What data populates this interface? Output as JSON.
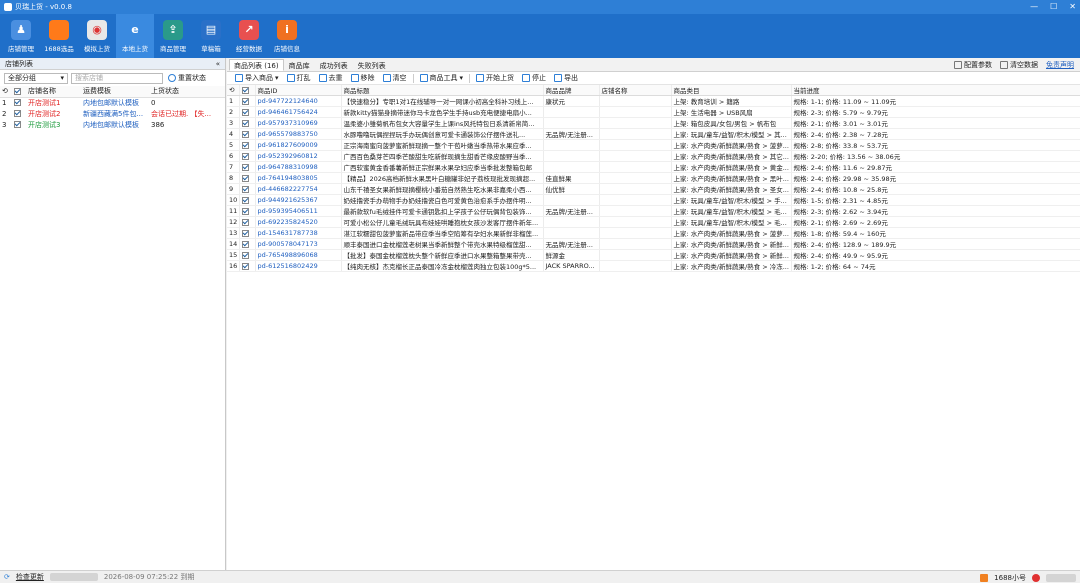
{
  "window": {
    "title": "贝瑞上货 - v0.0.8",
    "minimize": "—",
    "maximize": "☐",
    "close": "✕"
  },
  "toolbar": [
    {
      "label": "店铺管理",
      "icon": "user-icon",
      "color": "#4a8fe0",
      "glyph": "♟"
    },
    {
      "label": "1688选品",
      "icon": "1688-icon",
      "color": "#ff7a1a",
      "glyph": ""
    },
    {
      "label": "模拟上货",
      "icon": "chrome-icon",
      "color": "#e8e8e8",
      "glyph": "◉"
    },
    {
      "label": "本地上货",
      "icon": "ie-icon",
      "color": "#3a8ae0",
      "glyph": "e"
    },
    {
      "label": "商品管理",
      "icon": "upload-box-icon",
      "color": "#2a9a8a",
      "glyph": "⇪"
    },
    {
      "label": "草稿箱",
      "icon": "draft-icon",
      "color": "#2a70c8",
      "glyph": "▤"
    },
    {
      "label": "经营数据",
      "icon": "chart-icon",
      "color": "#e85050",
      "glyph": "↗"
    },
    {
      "label": "店铺信息",
      "icon": "info-icon",
      "color": "#f07020",
      "glyph": "i"
    }
  ],
  "left": {
    "title": "店铺列表",
    "collapse": "«",
    "group_select": "全部分组",
    "search_placeholder": "搜索店铺",
    "reset_label": "重置状态",
    "columns": [
      "",
      "",
      "店铺名称",
      "运费模板",
      "上货状态"
    ],
    "shops": [
      {
        "n": "1",
        "name": "开店测试1",
        "tpl": "内地包邮默认模板",
        "status": "0",
        "name_color": "red",
        "status_color": ""
      },
      {
        "n": "2",
        "name": "开店测试2",
        "tpl": "新疆西藏满5件包...",
        "status": "会话已过期. 【失...",
        "name_color": "red",
        "status_color": "red"
      },
      {
        "n": "3",
        "name": "开店测试3",
        "tpl": "内地包邮默认模板",
        "status": "386",
        "name_color": "green",
        "status_color": ""
      }
    ]
  },
  "tabs": [
    "商品列表 (16)",
    "商品库",
    "成功列表",
    "失败列表"
  ],
  "right_links": {
    "config": "配置参数",
    "clear": "清空数据",
    "disclaimer": "免责声明"
  },
  "actions": [
    "导入商品",
    "打乱",
    "去重",
    "移除",
    "清空",
    "商品工具",
    "开始上货",
    "停止",
    "导出"
  ],
  "goods_columns": [
    "",
    "",
    "商品ID",
    "商品标题",
    "商品品牌",
    "店铺名称",
    "商品类目",
    "当前进度"
  ],
  "goods": [
    [
      "1",
      "pd-947722124640",
      "【快速稳分】专职1对1在线辅导一对一网课小初高全科补习线上...",
      "康状元",
      "",
      "上架: 教育培训 > 籍路",
      "规格: 1-1; 价格: 11.09 ~ 11.09元"
    ],
    [
      "2",
      "pd-946461756424",
      "新款kitty猫猫身摘带迷你马卡龙色学生手持usb充电便捷电扇小...",
      "",
      "",
      "上架: 生活电器 > USB风扇",
      "规格: 2-3; 价格: 5.79 ~ 9.79元"
    ],
    [
      "3",
      "pd-957937310969",
      "温柔婆小雏菊帆布包女大容量学生上课ins风托特包日系清新帛简...",
      "",
      "",
      "上架: 箱包皮具/女包/男包 > 帆布包",
      "规格: 2-1; 价格: 3.01 ~ 3.01元"
    ],
    [
      "4",
      "pd-965579883750",
      "水豚噜噜玩偶捏捏玩手办玩偶创意可爱卡通装饰公仔摆件送礼...",
      "无品牌/无注册...",
      "",
      "上家: 玩具/童车/益智/积木/模型 > 其...",
      "规格: 2-4; 价格: 2.38 ~ 7.28元"
    ],
    [
      "5",
      "pd-961827609009",
      "正宗海南蜜向菠萝蜜新鲜现摘一整个干苞叶嫩当季热带水果应季...",
      "",
      "",
      "上家: 水产肉类/新鲜蔬果/熟食 > 菠萝...",
      "规格: 2-8; 价格: 33.8 ~ 53.7元"
    ],
    [
      "6",
      "pd-952392960812",
      "广西百色桑芽芒四季芒酸甜生吃新鲜现摘生甜香芒缘皮酸野当季...",
      "",
      "",
      "上家: 水产肉类/新鲜蔬果/熟食 > 其它...",
      "规格: 2-20; 价格: 13.56 ~ 38.06元"
    ],
    [
      "7",
      "pd-964788310998",
      "广西软蜜黄金香番薯新鲜正宗鲜果水果孕妇应季当季批发整箱包邮",
      "",
      "",
      "上家: 水产肉类/新鲜蔬果/熟食 > 黄金...",
      "规格: 2-4; 价格: 11.6 ~ 29.87元"
    ],
    [
      "8",
      "pd-764194803805",
      "【精品】2026高档新鲜水果黑叶白糖罐非妃子荔枝现批发现摘超...",
      "佳直鲜果",
      "",
      "上家: 水产肉类/新鲜蔬果/熟食 > 黑叶...",
      "规格: 2-4; 价格: 29.98 ~ 35.98元"
    ],
    [
      "9",
      "pd-446682227754",
      "山东千禧圣女果新鲜现摘樱桃小番茄自然熟生吃水果非嘉柔小西...",
      "仙优鲜",
      "",
      "上家: 水产肉类/新鲜蔬果/熟食 > 圣女...",
      "规格: 2-4; 价格: 10.8 ~ 25.8元"
    ],
    [
      "10",
      "pd-944921625367",
      "奶娃撸瓷手办萌物手办奶娃撸瓷白色可爱黄色治愈系手办摆件明...",
      "",
      "",
      "上家: 玩具/童车/益智/积木/模型 > 手...",
      "规格: 1-5; 价格: 2.31 ~ 4.85元"
    ],
    [
      "11",
      "pd-959395406511",
      "最新款软fu毛绒挂件可爱卡通钥匙扣上学孩子公仔玩偶背包装饰...",
      "无品牌/无注册...",
      "",
      "上家: 玩具/童车/益智/积木/模型 > 毛...",
      "规格: 2-3; 价格: 2.62 ~ 3.94元"
    ],
    [
      "12",
      "pd-692235824520",
      "可爱小松公仔儿童毛绒玩具布娃娃哄睡抱枕女孩沙发客厅摆件新年...",
      "",
      "",
      "上家: 玩具/童车/益智/积木/模型 > 毛...",
      "规格: 2-1; 价格: 2.69 ~ 2.69元"
    ],
    [
      "13",
      "pd-154631787738",
      "湛江软糯甜包菠萝蜜新品带应季当季空陷筹有孕妇水果新鲜非榴莲...",
      "",
      "",
      "上家: 水产肉类/新鲜蔬果/熟食 > 菠萝...",
      "规格: 1-8; 价格: 59.4 ~ 160元"
    ],
    [
      "14",
      "pd-900578047173",
      "顺丰泰国进口金枕榴莲老树果当季新鲜整个带壳水果特级榴莲甜...",
      "无品牌/无注册...",
      "",
      "上家: 水产肉类/新鲜蔬果/熟食 > 新鲜...",
      "规格: 2-4; 价格: 128.9 ~ 189.9元"
    ],
    [
      "15",
      "pd-765498896068",
      "【批发】泰国金枕榴莲枕头整个新鲜应季进口水果整箱整果带壳...",
      "鲜源金",
      "",
      "上家: 水产肉类/新鲜蔬果/熟食 > 新鲜...",
      "规格: 2-4; 价格: 49.9 ~ 95.9元"
    ],
    [
      "16",
      "pd-612516802429",
      "【纯肉无核】杰克榴长正品泰国冷冻金枕榴莲肉独立包装100g*5...",
      "JACK SPARRO...",
      "",
      "上家: 水产肉类/新鲜蔬果/熟食 > 冷冻...",
      "规格: 1-2; 价格: 64 ~ 74元"
    ]
  ],
  "status": {
    "check_update": "检查更新",
    "expire": "2026-08-09 07:25:22 到期",
    "account": "1688小号"
  }
}
